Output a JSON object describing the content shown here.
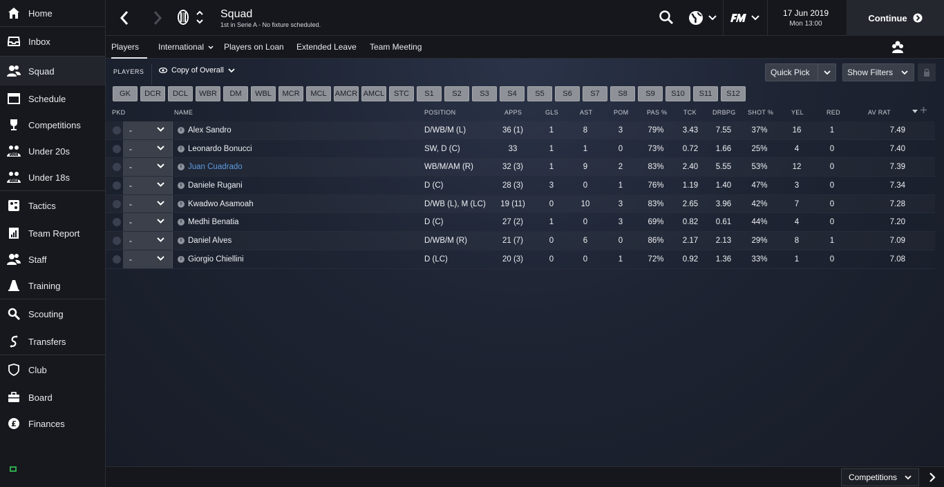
{
  "sidebar": {
    "items": [
      {
        "label": "Home",
        "icon": "home-icon"
      },
      {
        "label": "Inbox",
        "icon": "inbox-icon"
      },
      {
        "label": "Squad",
        "icon": "squad-icon"
      },
      {
        "label": "Schedule",
        "icon": "calendar-icon"
      },
      {
        "label": "Competitions",
        "icon": "trophy-icon"
      },
      {
        "label": "Under 20s",
        "icon": "u20-icon"
      },
      {
        "label": "Under 18s",
        "icon": "u18-icon"
      },
      {
        "label": "Tactics",
        "icon": "tactics-icon"
      },
      {
        "label": "Team Report",
        "icon": "report-icon"
      },
      {
        "label": "Staff",
        "icon": "staff-icon"
      },
      {
        "label": "Training",
        "icon": "cone-icon"
      },
      {
        "label": "Scouting",
        "icon": "scout-search-icon"
      },
      {
        "label": "Transfers",
        "icon": "transfers-icon"
      },
      {
        "label": "Club",
        "icon": "shield-icon"
      },
      {
        "label": "Board",
        "icon": "briefcase-icon"
      },
      {
        "label": "Finances",
        "icon": "pound-icon"
      }
    ]
  },
  "header": {
    "title": "Squad",
    "subtitle": "1st in Serie A - No fixture scheduled.",
    "date": "17 Jun 2019",
    "time": "Mon 13:00",
    "continue_label": "Continue"
  },
  "subnav": {
    "tabs": [
      "Players",
      "International",
      "Players on Loan",
      "Extended Leave",
      "Team Meeting"
    ]
  },
  "toolbar": {
    "players_label": "PLAYERS",
    "view_label": "Copy of Overall",
    "quick_pick_label": "Quick Pick",
    "show_filters_label": "Show Filters"
  },
  "positions": [
    "GK",
    "DCR",
    "DCL",
    "WBR",
    "DM",
    "WBL",
    "MCR",
    "MCL",
    "AMCR",
    "AMCL",
    "STC",
    "S1",
    "S2",
    "S3",
    "S4",
    "S5",
    "S6",
    "S7",
    "S8",
    "S9",
    "S10",
    "S11",
    "S12"
  ],
  "table": {
    "columns": [
      "PKD",
      "NAME",
      "POSITION",
      "APPS",
      "GLS",
      "AST",
      "POM",
      "PAS %",
      "TCK",
      "DRBPG",
      "SHOT %",
      "YEL",
      "RED",
      "AV RAT"
    ],
    "rows": [
      {
        "pkd": "-",
        "name": "Alex Sandro",
        "position": "D/WB/M (L)",
        "apps": "36 (1)",
        "gls": "1",
        "ast": "8",
        "pom": "3",
        "pas": "79%",
        "tck": "3.43",
        "drbpg": "7.55",
        "shot": "37%",
        "yel": "16",
        "red": "1",
        "avrat": "7.49"
      },
      {
        "pkd": "-",
        "name": "Leonardo Bonucci",
        "position": "SW, D (C)",
        "apps": "33",
        "gls": "1",
        "ast": "1",
        "pom": "0",
        "pas": "73%",
        "tck": "0.72",
        "drbpg": "1.66",
        "shot": "25%",
        "yel": "4",
        "red": "0",
        "avrat": "7.40"
      },
      {
        "pkd": "-",
        "name": "Juan Cuadrado",
        "position": "WB/M/AM (R)",
        "apps": "32 (3)",
        "gls": "1",
        "ast": "9",
        "pom": "2",
        "pas": "83%",
        "tck": "2.40",
        "drbpg": "5.55",
        "shot": "53%",
        "yel": "12",
        "red": "0",
        "avrat": "7.39"
      },
      {
        "pkd": "-",
        "name": "Daniele Rugani",
        "position": "D (C)",
        "apps": "28 (3)",
        "gls": "3",
        "ast": "0",
        "pom": "1",
        "pas": "76%",
        "tck": "1.19",
        "drbpg": "1.40",
        "shot": "47%",
        "yel": "3",
        "red": "0",
        "avrat": "7.34"
      },
      {
        "pkd": "-",
        "name": "Kwadwo Asamoah",
        "position": "D/WB (L), M (LC)",
        "apps": "19 (11)",
        "gls": "0",
        "ast": "10",
        "pom": "3",
        "pas": "83%",
        "tck": "2.65",
        "drbpg": "3.96",
        "shot": "42%",
        "yel": "7",
        "red": "0",
        "avrat": "7.28"
      },
      {
        "pkd": "-",
        "name": "Medhi Benatia",
        "position": "D (C)",
        "apps": "27 (2)",
        "gls": "1",
        "ast": "0",
        "pom": "3",
        "pas": "69%",
        "tck": "0.82",
        "drbpg": "0.61",
        "shot": "44%",
        "yel": "4",
        "red": "0",
        "avrat": "7.20"
      },
      {
        "pkd": "-",
        "name": "Daniel Alves",
        "position": "D/WB/M (R)",
        "apps": "21 (7)",
        "gls": "0",
        "ast": "6",
        "pom": "0",
        "pas": "86%",
        "tck": "2.17",
        "drbpg": "2.13",
        "shot": "29%",
        "yel": "8",
        "red": "1",
        "avrat": "7.09"
      },
      {
        "pkd": "-",
        "name": "Giorgio Chiellini",
        "position": "D (LC)",
        "apps": "20 (3)",
        "gls": "0",
        "ast": "0",
        "pom": "1",
        "pas": "72%",
        "tck": "0.92",
        "drbpg": "1.36",
        "shot": "33%",
        "yel": "1",
        "red": "0",
        "avrat": "7.08"
      }
    ]
  },
  "bottombar": {
    "competitions_label": "Competitions"
  },
  "colors": {
    "highlight_name": "#5c9be0",
    "position_button": "#8e9197"
  }
}
